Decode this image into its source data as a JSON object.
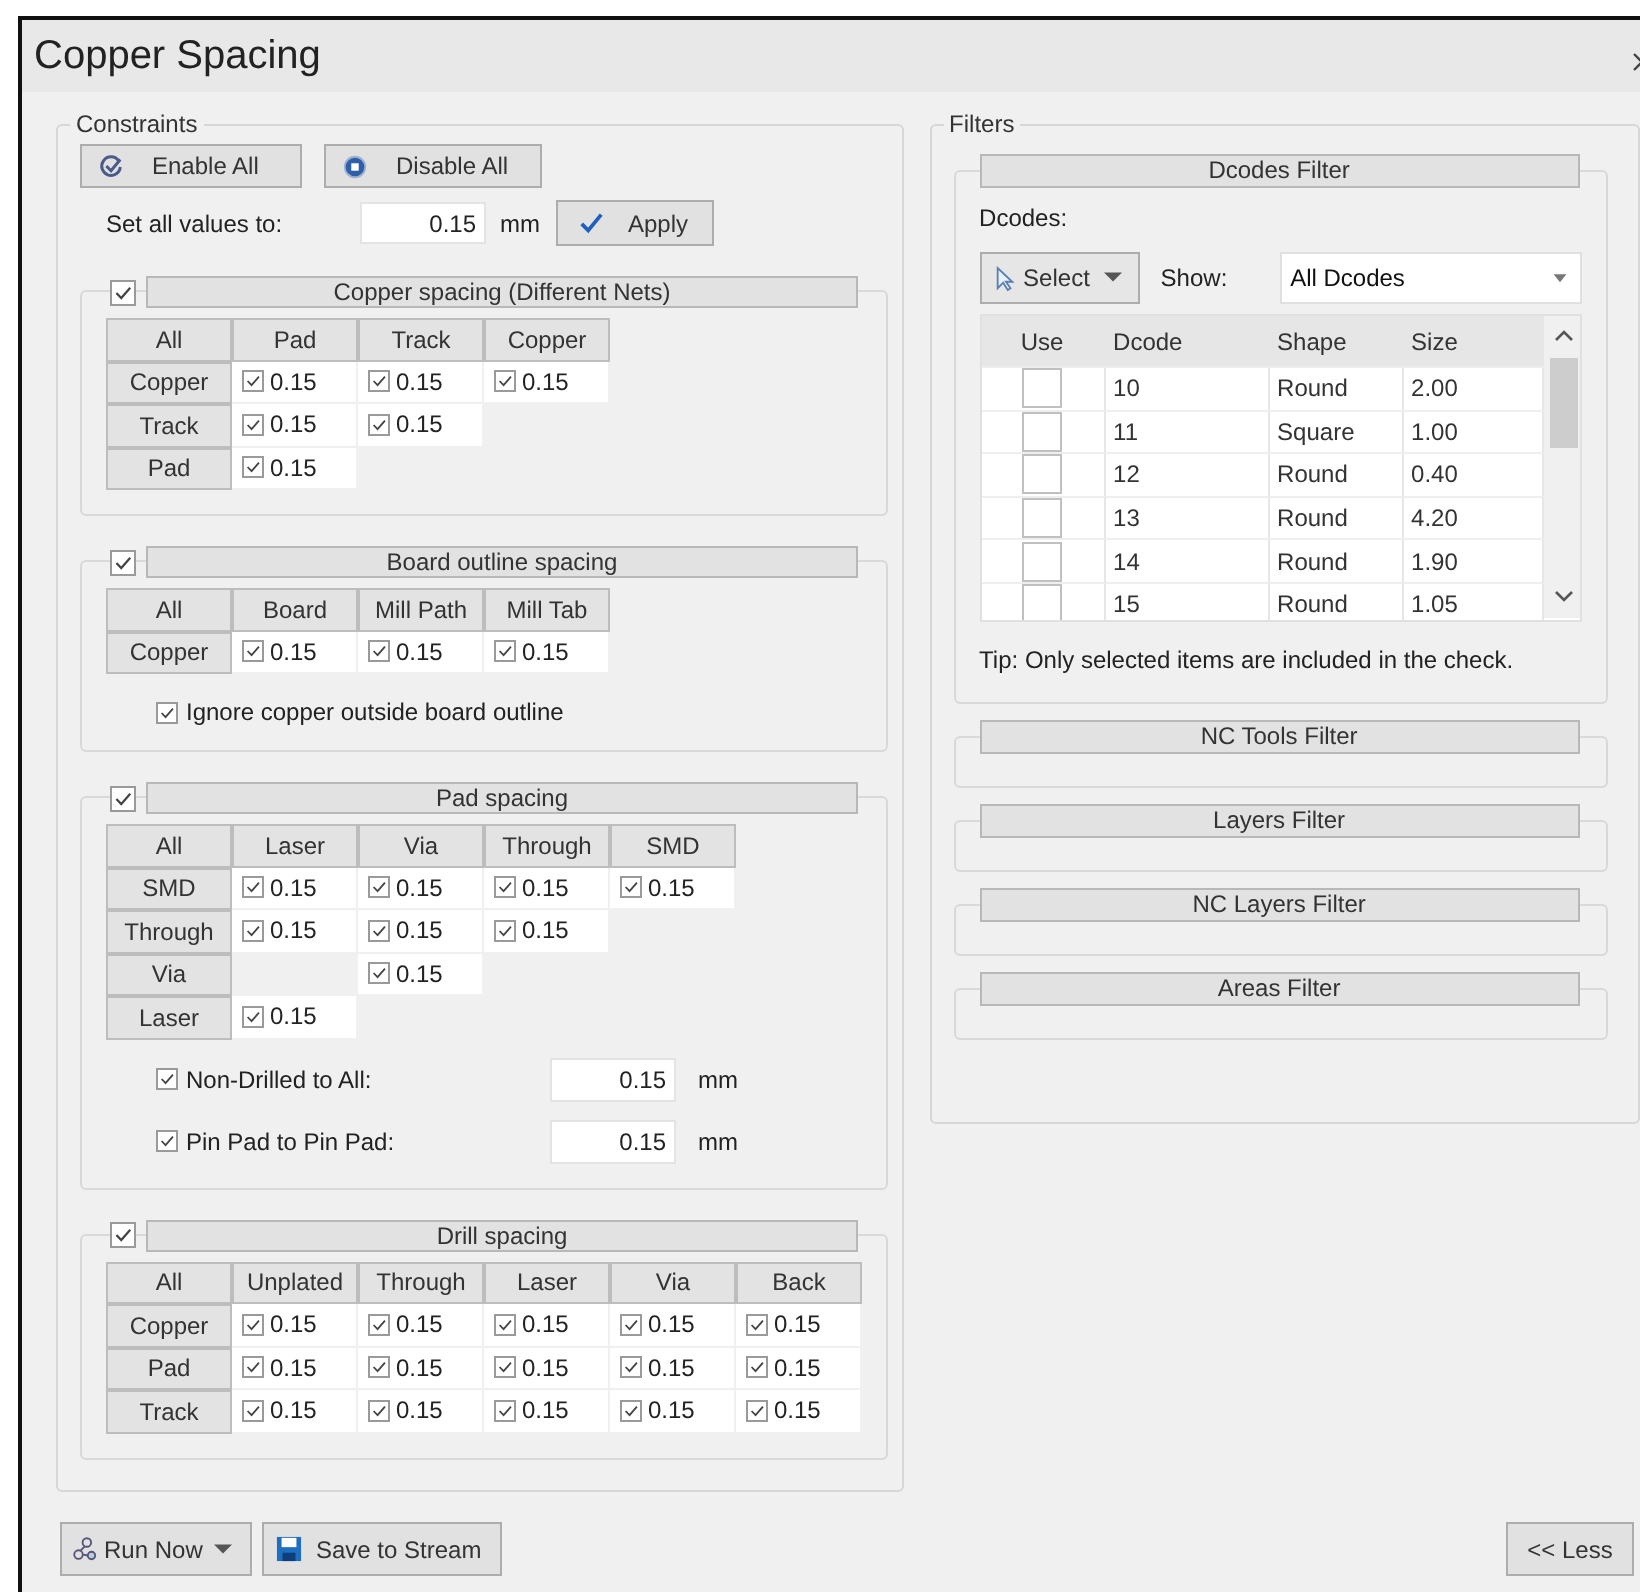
{
  "window": {
    "title": "Copper Spacing"
  },
  "constraints": {
    "title": "Constraints",
    "enable_all": "Enable All",
    "disable_all": "Disable All",
    "set_all_label": "Set all values to:",
    "set_all_value": "0.15",
    "unit": "mm",
    "apply": "Apply",
    "sections": [
      {
        "title": "Copper spacing (Different Nets)",
        "checked": true,
        "corner": "All",
        "columns": [
          "Pad",
          "Track",
          "Copper"
        ],
        "rows": [
          {
            "label": "Copper",
            "cells": [
              {
                "checked": true,
                "value": "0.15"
              },
              {
                "checked": true,
                "value": "0.15"
              },
              {
                "checked": true,
                "value": "0.15"
              }
            ]
          },
          {
            "label": "Track",
            "cells": [
              {
                "checked": true,
                "value": "0.15"
              },
              {
                "checked": true,
                "value": "0.15"
              },
              ""
            ]
          },
          {
            "label": "Pad",
            "cells": [
              {
                "checked": true,
                "value": "0.15"
              },
              "",
              ""
            ]
          }
        ]
      },
      {
        "title": "Board outline spacing",
        "checked": true,
        "corner": "All",
        "columns": [
          "Board",
          "Mill Path",
          "Mill Tab"
        ],
        "rows": [
          {
            "label": "Copper",
            "cells": [
              {
                "checked": true,
                "value": "0.15"
              },
              {
                "checked": true,
                "value": "0.15"
              },
              {
                "checked": true,
                "value": "0.15"
              }
            ]
          }
        ],
        "options": [
          {
            "kind": "checkbox",
            "label": "Ignore copper outside board outline",
            "checked": true
          }
        ]
      },
      {
        "title": "Pad spacing",
        "checked": true,
        "corner": "All",
        "columns": [
          "Laser",
          "Via",
          "Through",
          "SMD"
        ],
        "rows": [
          {
            "label": "SMD",
            "cells": [
              {
                "checked": true,
                "value": "0.15"
              },
              {
                "checked": true,
                "value": "0.15"
              },
              {
                "checked": true,
                "value": "0.15"
              },
              {
                "checked": true,
                "value": "0.15"
              }
            ]
          },
          {
            "label": "Through",
            "cells": [
              {
                "checked": true,
                "value": "0.15"
              },
              {
                "checked": true,
                "value": "0.15"
              },
              {
                "checked": true,
                "value": "0.15"
              },
              ""
            ]
          },
          {
            "label": "Via",
            "cells": [
              "",
              {
                "checked": true,
                "value": "0.15"
              },
              "",
              ""
            ]
          },
          {
            "label": "Laser",
            "cells": [
              {
                "checked": true,
                "value": "0.15"
              },
              "",
              "",
              ""
            ]
          }
        ],
        "options": [
          {
            "kind": "value",
            "label": "Non-Drilled to All:",
            "checked": true,
            "value": "0.15",
            "unit": "mm"
          },
          {
            "kind": "value",
            "label": "Pin Pad to Pin Pad:",
            "checked": true,
            "value": "0.15",
            "unit": "mm"
          }
        ]
      },
      {
        "title": "Drill spacing",
        "checked": true,
        "corner": "All",
        "columns": [
          "Unplated",
          "Through",
          "Laser",
          "Via",
          "Back"
        ],
        "rows": [
          {
            "label": "Copper",
            "cells": [
              {
                "checked": true,
                "value": "0.15"
              },
              {
                "checked": true,
                "value": "0.15"
              },
              {
                "checked": true,
                "value": "0.15"
              },
              {
                "checked": true,
                "value": "0.15"
              },
              {
                "checked": true,
                "value": "0.15"
              }
            ]
          },
          {
            "label": "Pad",
            "cells": [
              {
                "checked": true,
                "value": "0.15"
              },
              {
                "checked": true,
                "value": "0.15"
              },
              {
                "checked": true,
                "value": "0.15"
              },
              {
                "checked": true,
                "value": "0.15"
              },
              {
                "checked": true,
                "value": "0.15"
              }
            ]
          },
          {
            "label": "Track",
            "cells": [
              {
                "checked": true,
                "value": "0.15"
              },
              {
                "checked": true,
                "value": "0.15"
              },
              {
                "checked": true,
                "value": "0.15"
              },
              {
                "checked": true,
                "value": "0.15"
              },
              {
                "checked": true,
                "value": "0.15"
              }
            ]
          }
        ]
      }
    ]
  },
  "filters": {
    "title": "Filters",
    "dcodes": {
      "title": "Dcodes Filter",
      "label": "Dcodes:",
      "select": "Select",
      "show_label": "Show:",
      "show_value": "All Dcodes",
      "columns": [
        "Use",
        "Dcode",
        "Shape",
        "Size"
      ],
      "rows": [
        {
          "use": false,
          "dcode": "10",
          "shape": "Round",
          "size": "2.00"
        },
        {
          "use": false,
          "dcode": "11",
          "shape": "Square",
          "size": "1.00"
        },
        {
          "use": false,
          "dcode": "12",
          "shape": "Round",
          "size": "0.40"
        },
        {
          "use": false,
          "dcode": "13",
          "shape": "Round",
          "size": "4.20"
        },
        {
          "use": false,
          "dcode": "14",
          "shape": "Round",
          "size": "1.90"
        },
        {
          "use": false,
          "dcode": "15",
          "shape": "Round",
          "size": "1.05"
        }
      ],
      "tip": "Tip: Only selected items are included in the check."
    },
    "other": [
      "NC Tools Filter",
      "Layers Filter",
      "NC Layers Filter",
      "Areas Filter"
    ]
  },
  "footer": {
    "run_now": "Run Now",
    "save": "Save to Stream",
    "less": "<< Less"
  }
}
